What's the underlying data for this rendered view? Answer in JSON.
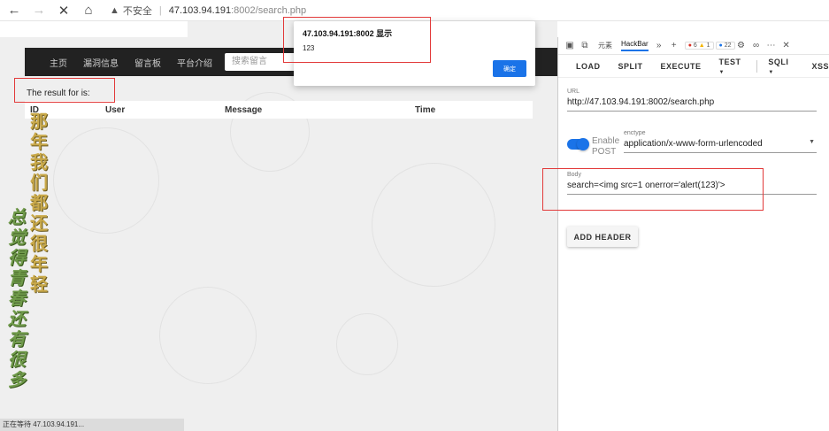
{
  "browser": {
    "security_label": "不安全",
    "url_host": "47.103.94.191",
    "url_path": ":8002/search.php"
  },
  "page": {
    "nav_items": [
      "主页",
      "漏洞信息",
      "留言板",
      "平台介绍"
    ],
    "search_placeholder": "搜索留言",
    "result_text": "The result for  is:",
    "table_headers": {
      "id": "ID",
      "user": "User",
      "message": "Message",
      "time": "Time"
    },
    "poem_line1": [
      "那",
      "年",
      "我",
      "们",
      "都",
      "还",
      "很",
      "年",
      "轻"
    ],
    "poem_line2": [
      "总",
      "觉",
      "得",
      "青",
      "春",
      "还",
      "有",
      "很",
      "多"
    ],
    "status_text": "正在等待 47.103.94.191..."
  },
  "alert": {
    "title": "47.103.94.191:8002 显示",
    "message": "123",
    "ok_label": "确定"
  },
  "devtools": {
    "tabs": [
      "元素",
      "HackBar"
    ],
    "active_tab": "HackBar",
    "error_count": "6",
    "warning_count": "1",
    "info_count": "22",
    "hackbar_menu": [
      "LOAD",
      "SPLIT",
      "EXECUTE",
      "TEST",
      "SQLI",
      "XSS"
    ],
    "url_label": "URL",
    "url_value": "http://47.103.94.191:8002/search.php",
    "enable_post_label": "Enable POST",
    "enable_post_on": true,
    "enctype_label": "enctype",
    "enctype_value": "application/x-www-form-urlencoded",
    "body_label": "Body",
    "body_value": "search=<img src=1 onerror='alert(123)'>",
    "add_header_label": "ADD HEADER"
  },
  "colors": {
    "accent": "#1a73e8",
    "highlight_box": "#e23a3a",
    "navbar_bg": "#222222"
  }
}
